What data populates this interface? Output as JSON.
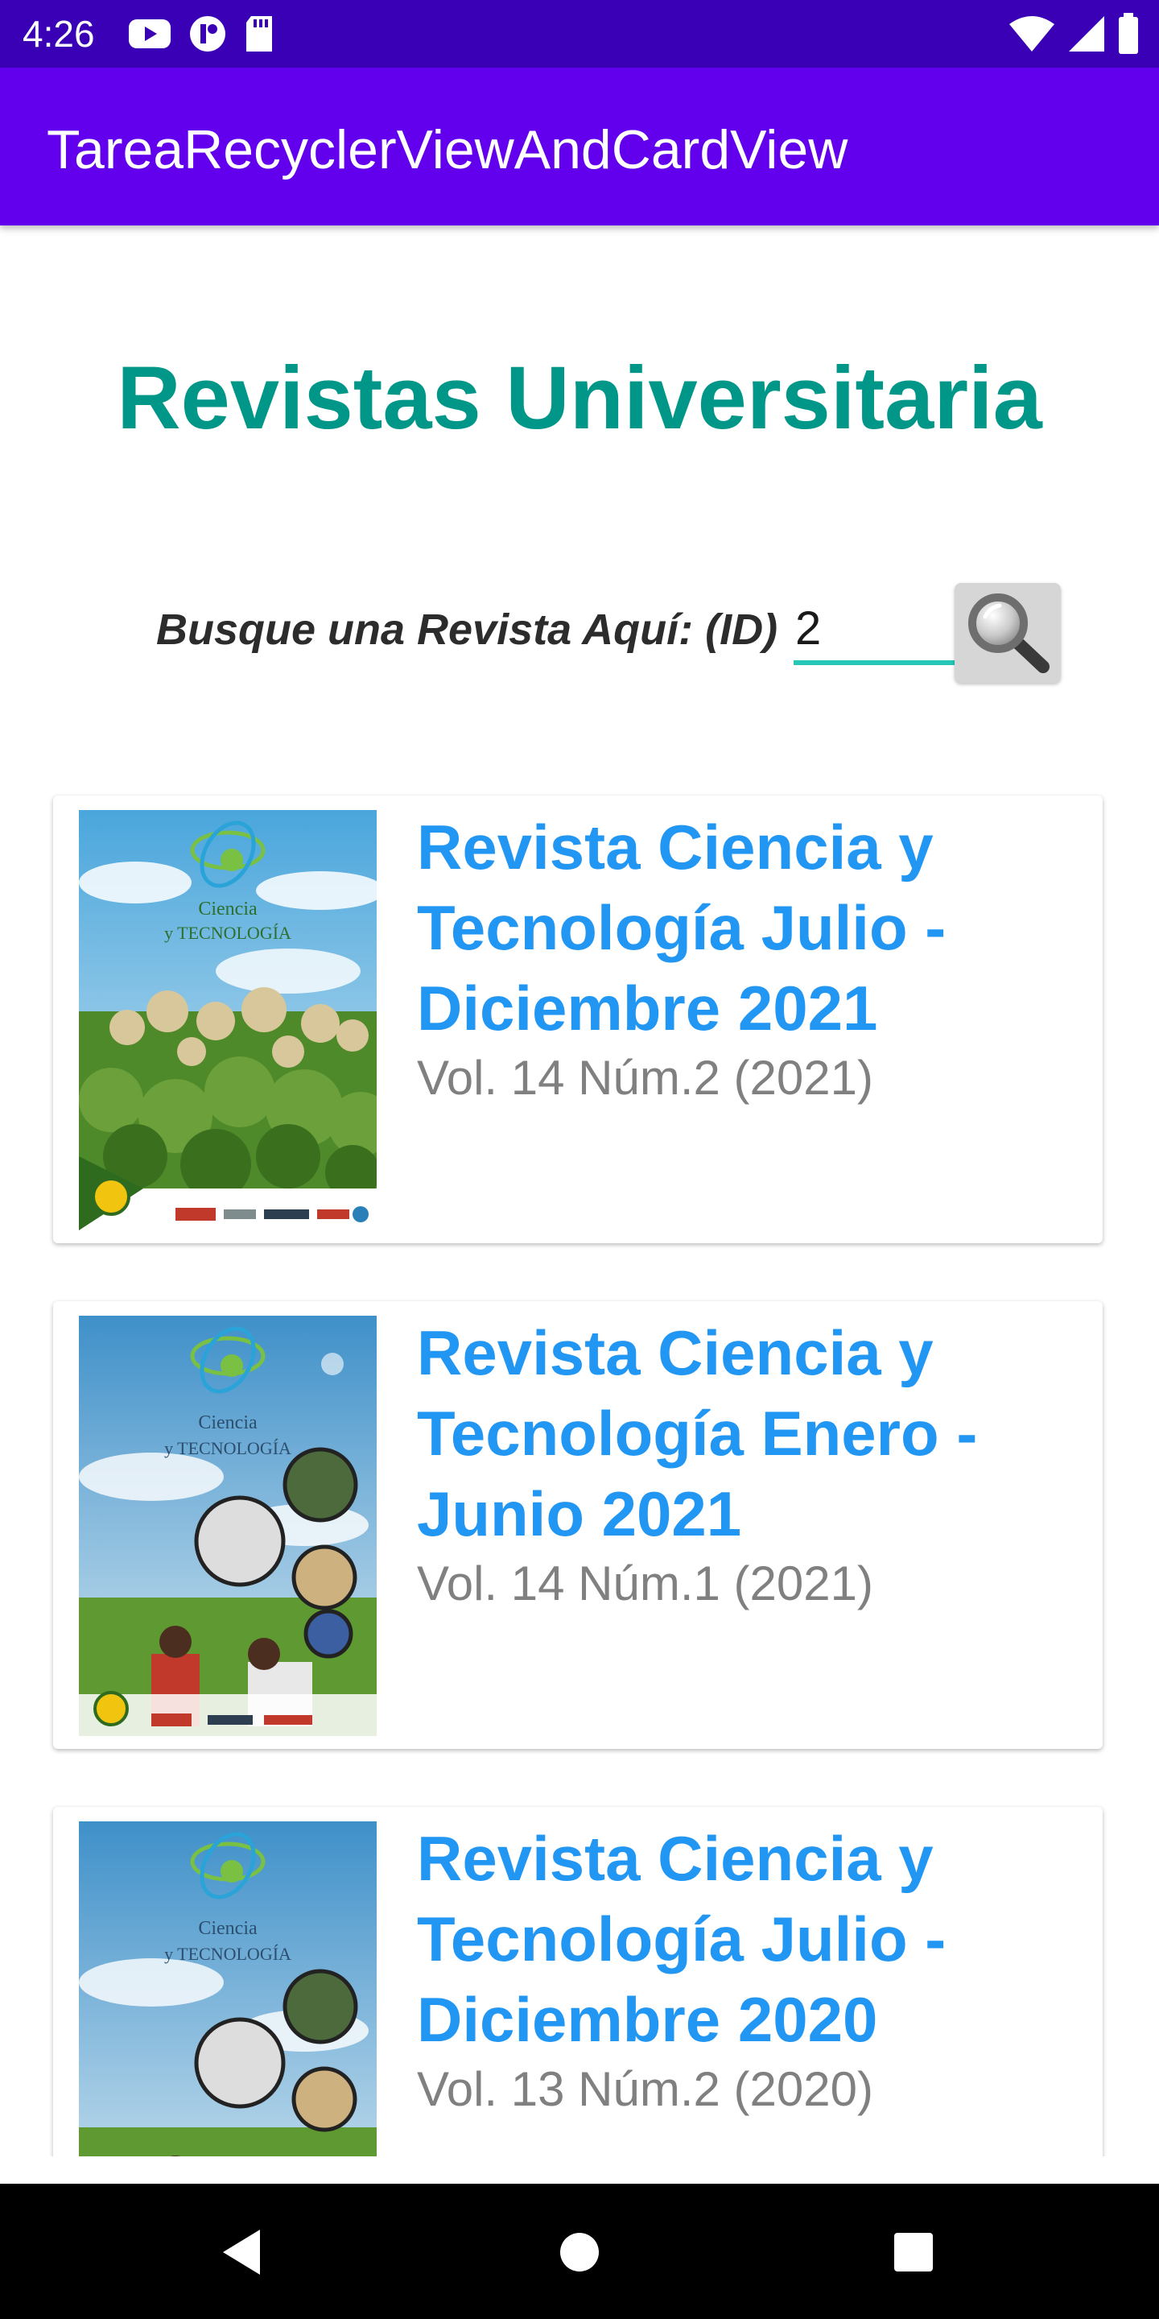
{
  "status_bar": {
    "time": "4:26",
    "left_icons": [
      "youtube-icon",
      "app-icon",
      "sd-card-icon"
    ],
    "right_icons": [
      "wifi-icon",
      "signal-icon",
      "battery-icon"
    ],
    "background": "#3a00b5"
  },
  "app_bar": {
    "title": "TareaRecyclerViewAndCardView",
    "background": "#6200ee"
  },
  "heading": {
    "text": "Revistas Universitaria",
    "color": "#009688"
  },
  "search": {
    "label": "Busque una Revista Aquí: (ID)",
    "value": "2",
    "button_icon": "search-icon"
  },
  "journals": [
    {
      "title": "Revista Ciencia y Tecnología Julio - Diciembre 2021",
      "volume": "Vol. 14 Núm.2 (2021)",
      "cover": {
        "logo_text": "Ciencia\ny TECNOLOGÍA",
        "style": "plants"
      }
    },
    {
      "title": "Revista Ciencia y Tecnología Enero - Junio 2021",
      "volume": "Vol. 14 Núm.1 (2021)",
      "cover": {
        "logo_text": "Ciencia\ny TECNOLOGÍA",
        "style": "people"
      }
    },
    {
      "title": "Revista Ciencia y Tecnología Julio - Diciembre 2020",
      "volume": "Vol. 13 Núm.2 (2020)",
      "cover": {
        "logo_text": "Ciencia\ny TECNOLOGÍA",
        "style": "people"
      }
    }
  ],
  "colors": {
    "card_title": "#2196f3",
    "card_subtitle": "#808080",
    "input_underline": "#26c6b8"
  },
  "nav_bar": {
    "buttons": [
      "back-icon",
      "home-icon",
      "recents-icon"
    ]
  }
}
